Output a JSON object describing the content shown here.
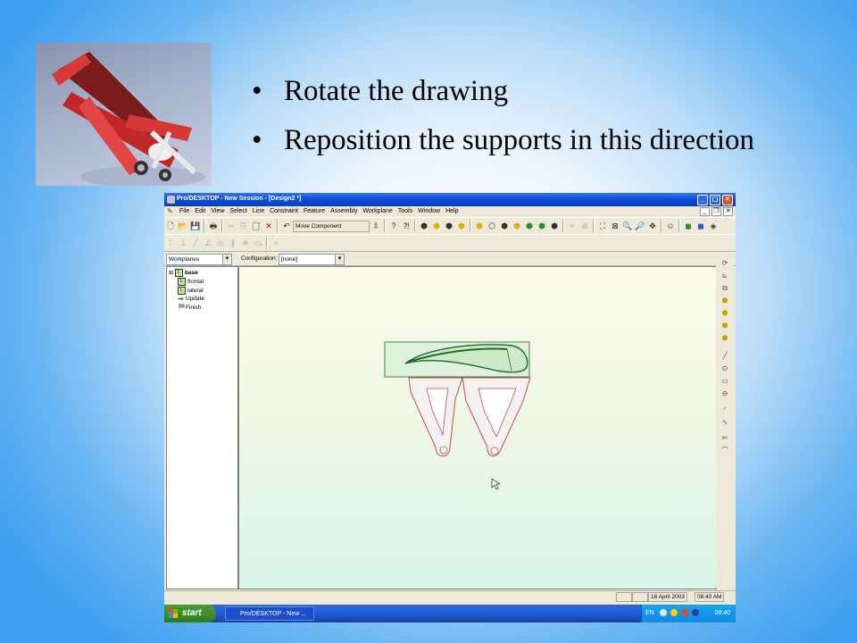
{
  "slide": {
    "bullets": [
      "Rotate the drawing",
      "Reposition the supports in this direction"
    ],
    "bullet_char": "•"
  },
  "window": {
    "title": "Pro/DESKTOP - New Session - [Design2 *]",
    "menu": [
      "File",
      "Edit",
      "View",
      "Select",
      "Line",
      "Constraint",
      "Feature",
      "Assembly",
      "Workplane",
      "Tools",
      "Window",
      "Help"
    ],
    "tool_combo": "Move Component",
    "workplanes_combo": "Workplanes",
    "configuration_label": "Configuration:",
    "configuration_value": "[none]",
    "tree": {
      "root": "base",
      "children": [
        "frontal",
        "lateral",
        "Update",
        "Finish"
      ]
    },
    "status": {
      "date": "18 April 2003",
      "time": "08:40 AM"
    }
  },
  "taskbar": {
    "start_label": "start",
    "task_label": "Pro/DESKTOP - New ...",
    "lang": "EN",
    "clock": "08:40"
  },
  "colors": {
    "taskbar_blue": "#245edb",
    "start_green": "#3c8a2b",
    "part_red": "#c84a4a",
    "selection_green": "#2e8b3a"
  }
}
